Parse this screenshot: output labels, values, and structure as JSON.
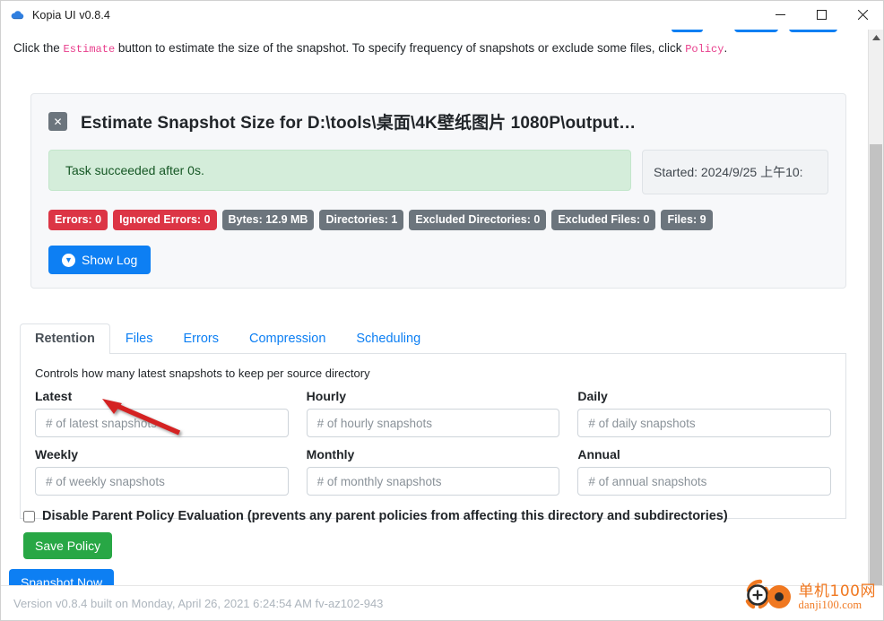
{
  "window": {
    "title": "Kopia UI v0.8.4",
    "icon": "kopia-cloud-icon",
    "controls": {
      "minimize": "minimize-icon",
      "maximize": "maximize-icon",
      "close": "close-icon"
    }
  },
  "help": {
    "prefix": "Click the ",
    "code1": "Estimate",
    "middle": " button to estimate the size of the snapshot. To specify frequency of snapshots or exclude some files, click ",
    "code2": "Policy",
    "suffix": "."
  },
  "estimate_card": {
    "close_glyph": "✕",
    "title": "Estimate Snapshot Size for D:\\tools\\桌面\\4K壁纸图片 1080P\\output…",
    "status_message": "Task succeeded after 0s.",
    "started": "Started: 2024/9/25 上午10:",
    "badges": [
      {
        "label": "Errors: 0",
        "style": "danger"
      },
      {
        "label": "Ignored Errors: 0",
        "style": "danger"
      },
      {
        "label": "Bytes: 12.9 MB",
        "style": "secondary"
      },
      {
        "label": "Directories: 1",
        "style": "secondary"
      },
      {
        "label": "Excluded Directories: 0",
        "style": "secondary"
      },
      {
        "label": "Excluded Files: 0",
        "style": "secondary"
      },
      {
        "label": "Files: 9",
        "style": "secondary"
      }
    ],
    "show_log_label": "Show Log",
    "show_log_icon": "chevron-down-circle-icon"
  },
  "tabs": [
    {
      "label": "Retention",
      "active": true
    },
    {
      "label": "Files",
      "active": false
    },
    {
      "label": "Errors",
      "active": false
    },
    {
      "label": "Compression",
      "active": false
    },
    {
      "label": "Scheduling",
      "active": false
    }
  ],
  "retention": {
    "description": "Controls how many latest snapshots to keep per source directory",
    "fields": [
      {
        "label": "Latest",
        "value": "",
        "placeholder": "# of latest snapshots"
      },
      {
        "label": "Hourly",
        "value": "",
        "placeholder": "# of hourly snapshots"
      },
      {
        "label": "Daily",
        "value": "",
        "placeholder": "# of daily snapshots"
      },
      {
        "label": "Weekly",
        "value": "",
        "placeholder": "# of weekly snapshots"
      },
      {
        "label": "Monthly",
        "value": "",
        "placeholder": "# of monthly snapshots"
      },
      {
        "label": "Annual",
        "value": "",
        "placeholder": "# of annual snapshots"
      }
    ]
  },
  "bottom": {
    "disable_parent_label": "Disable Parent Policy Evaluation (prevents any parent policies from affecting this directory and subdirectories)",
    "disable_parent_checked": false,
    "save_policy_label": "Save Policy",
    "snapshot_now_label": "Snapshot Now"
  },
  "footer": {
    "version_text": "Version v0.8.4 built on Monday, April 26, 2021 6:24:54 AM fv-az102-943"
  },
  "watermark": {
    "cn": "单机100网",
    "en": "danji100.com"
  },
  "colors": {
    "accent_blue": "#0d7ff3",
    "success_green": "#28a745",
    "danger_red": "#dc3545",
    "secondary_gray": "#6c757d",
    "alert_bg": "#d4edda",
    "alert_text": "#155724",
    "annotation_arrow": "#d42020",
    "watermark_orange": "#f07820"
  },
  "annotation": {
    "arrow_name": "red-pointer-arrow",
    "points_to": "Latest"
  }
}
